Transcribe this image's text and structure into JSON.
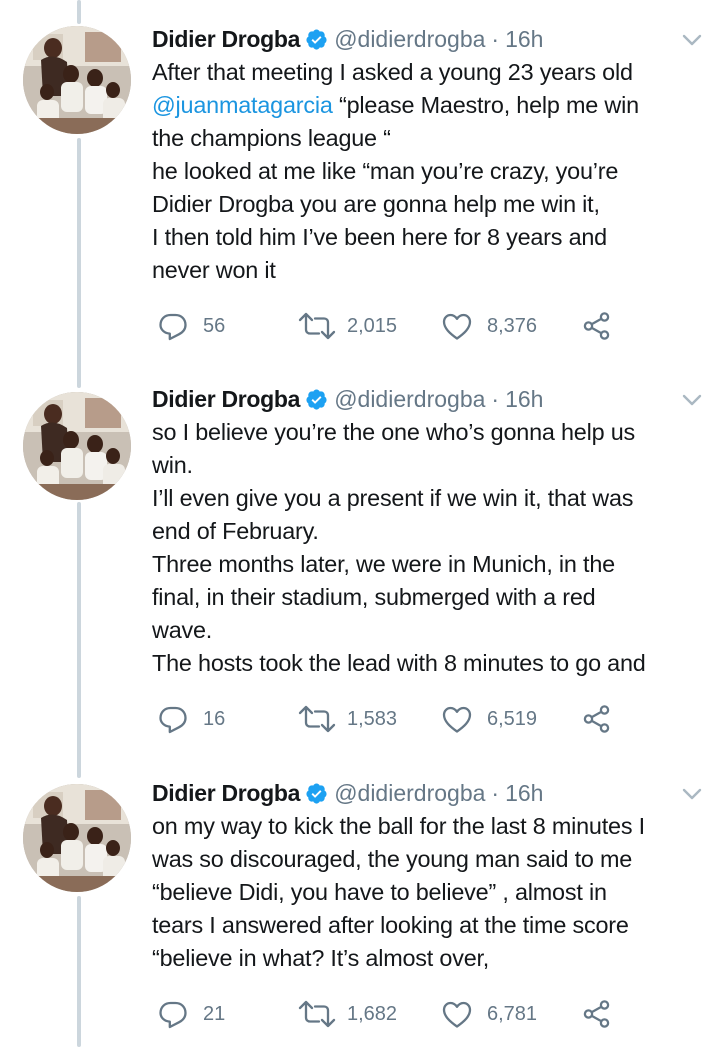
{
  "tweets": [
    {
      "name": "Didier Drogba",
      "handle": "@didierdrogba",
      "separator": "·",
      "time": "16h",
      "lines": [
        [
          "After that meeting I asked a young 23 years old"
        ],
        [
          "@juanmatagarcia",
          " “please Maestro, help me win"
        ],
        [
          "the champions league “"
        ],
        [
          "he looked at me like “man you’re crazy, you’re"
        ],
        [
          "Didier Drogba you are gonna help me win it,"
        ],
        [
          "I then told him I’ve been here for 8 years and"
        ],
        [
          "never won it"
        ]
      ],
      "replies": "56",
      "retweets": "2,015",
      "likes": "8,376"
    },
    {
      "name": "Didier Drogba",
      "handle": "@didierdrogba",
      "separator": "·",
      "time": "16h",
      "lines": [
        [
          "so I believe you’re the one who’s gonna help us"
        ],
        [
          "win."
        ],
        [
          "I’ll even give you a present if we win it, that was"
        ],
        [
          "end of February."
        ],
        [
          "Three months later, we were in Munich, in the"
        ],
        [
          "final, in their stadium, submerged with a red"
        ],
        [
          "wave."
        ],
        [
          "The hosts took the lead with 8 minutes to go and"
        ]
      ],
      "replies": "16",
      "retweets": "1,583",
      "likes": "6,519"
    },
    {
      "name": "Didier Drogba",
      "handle": "@didierdrogba",
      "separator": "·",
      "time": "16h",
      "lines": [
        [
          "on my way to kick the ball for the last 8 minutes I"
        ],
        [
          "was so discouraged, the young man said to me"
        ],
        [
          "“believe Didi, you have to believe” , almost in"
        ],
        [
          "tears I answered after looking at the time score"
        ],
        [
          "“believe in what? It’s almost over,"
        ]
      ],
      "replies": "21",
      "retweets": "1,682",
      "likes": "6,781"
    }
  ],
  "colors": {
    "text": "#14171a",
    "secondary": "#657786",
    "link": "#1b95e0",
    "verified": "#1da1f2",
    "thread_line": "#ccd6dd"
  },
  "icons": [
    "verified-badge-icon",
    "chevron-down-icon",
    "reply-icon",
    "retweet-icon",
    "like-icon",
    "share-icon"
  ]
}
